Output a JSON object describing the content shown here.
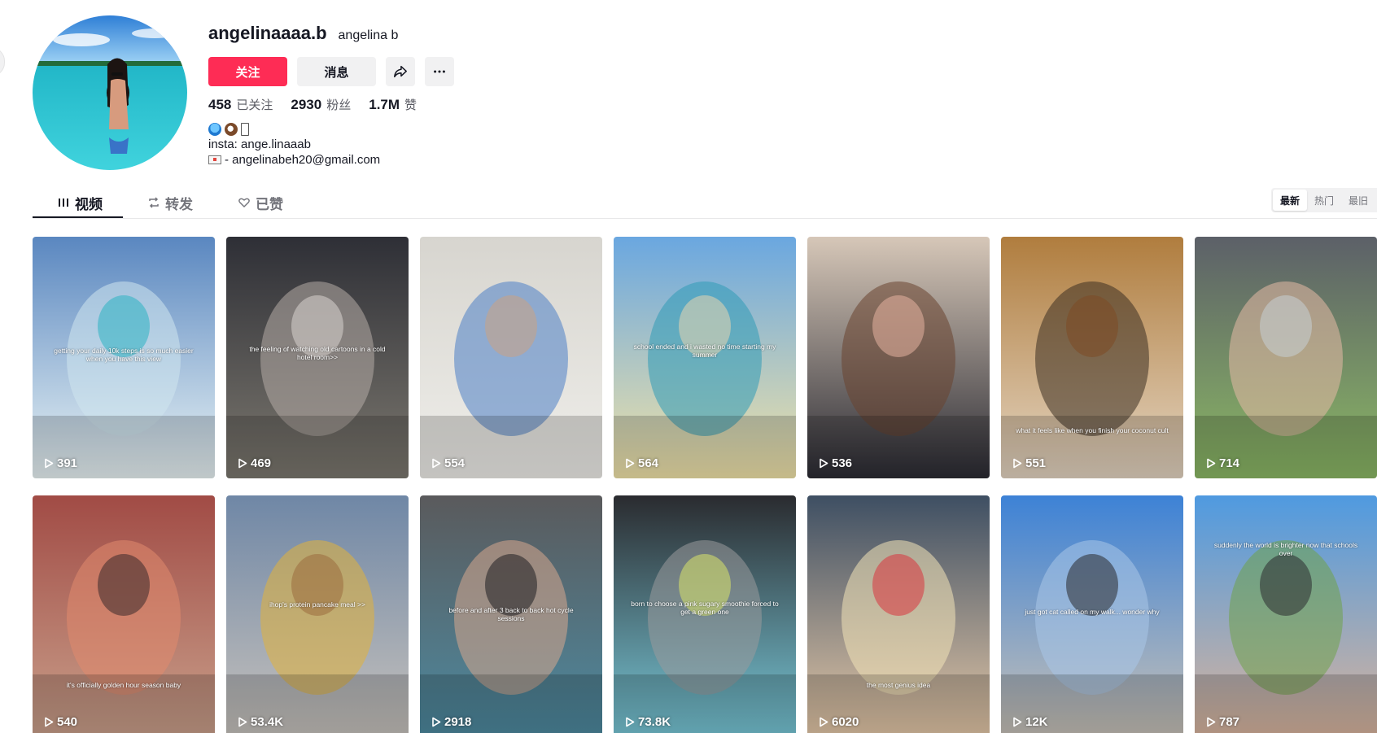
{
  "profile": {
    "username": "angelinaaaa.b",
    "nickname": "angelina b",
    "follow_label": "关注",
    "message_label": "消息",
    "stats": {
      "following_count": "458",
      "following_label": "已关注",
      "followers_count": "2930",
      "followers_label": "粉丝",
      "likes_count": "1.7M",
      "likes_label": "赞"
    },
    "bio": {
      "line1_emojis": [
        "wave",
        "coconut",
        "box"
      ],
      "line2": "insta: ange.linaaab",
      "line3": "- angelinabeh20@gmail.com"
    }
  },
  "tabs": {
    "videos": "视频",
    "reposts": "转发",
    "liked": "已赞"
  },
  "sort": {
    "latest": "最新",
    "popular": "热门",
    "oldest": "最旧",
    "selected": "最新"
  },
  "videos": [
    {
      "views": "391",
      "caption": "getting your daily 10k steps is so much easier when you have this view",
      "palette": [
        "#5a87c0",
        "#cfe5ee",
        "#2bb3c2",
        "#eaf4f5"
      ]
    },
    {
      "views": "469",
      "caption": "the feeling of watching old cartoons in a cold hotel room>>",
      "palette": [
        "#2e2f36",
        "#b4aba6",
        "#d9d4cf",
        "#7c786f"
      ]
    },
    {
      "views": "554",
      "caption": "",
      "palette": [
        "#d7d5cf",
        "#4c80c6",
        "#caa384",
        "#efeeea"
      ]
    },
    {
      "views": "564",
      "caption": "school ended and i wasted no time starting my summer",
      "palette": [
        "#6aa7e0",
        "#2f9bb7",
        "#e7d5b0",
        "#f1e3a8"
      ]
    },
    {
      "views": "536",
      "caption": "",
      "palette": [
        "#d6c7b8",
        "#6a4330",
        "#e6b3a0",
        "#2b2b33"
      ]
    },
    {
      "views": "551",
      "caption": "what it feels like when you finish your coconut cult",
      "palette": [
        "#b07d3e",
        "#3c2f22",
        "#7d4a25",
        "#e4d5c2"
      ]
    },
    {
      "views": "714",
      "caption": "",
      "palette": [
        "#5c6068",
        "#e6b9a6",
        "#c7cfd4",
        "#8bb864"
      ]
    },
    {
      "views": "540",
      "caption": "it's officially golden hour season baby",
      "palette": [
        "#a14b45",
        "#e28a6e",
        "#3b2a2b",
        "#c9a08b"
      ]
    },
    {
      "views": "53.4K",
      "caption": "ihop's protein pancake meal >>",
      "palette": [
        "#6f87a6",
        "#e2b23b",
        "#9a6b3e",
        "#c7c2bc"
      ]
    },
    {
      "views": "2918",
      "caption": "before and after 3 back to back hot cycle sessions",
      "palette": [
        "#5a5a5c",
        "#d7a88e",
        "#1f1f22",
        "#4d8aa0"
      ]
    },
    {
      "views": "73.8K",
      "caption": "born to choose a pink sugary smoothie forced to get a green one",
      "palette": [
        "#2a2b2f",
        "#9a9a9c",
        "#d9e36a",
        "#78c8d8"
      ]
    },
    {
      "views": "6020",
      "caption": "the most genius idea",
      "palette": [
        "#3e4f63",
        "#f3e4b8",
        "#d8343e",
        "#e5c8a7"
      ]
    },
    {
      "views": "12K",
      "caption": "just got cat called on my walk... wonder why",
      "palette": [
        "#3d82d6",
        "#a9c7e7",
        "#2a2a2e",
        "#c8c1b6"
      ]
    },
    {
      "views": "787",
      "caption": "suddenly the world is brighter now that schools over",
      "palette": [
        "#4f9ae0",
        "#6fa24a",
        "#2b2b2f",
        "#d9b49c"
      ]
    }
  ]
}
